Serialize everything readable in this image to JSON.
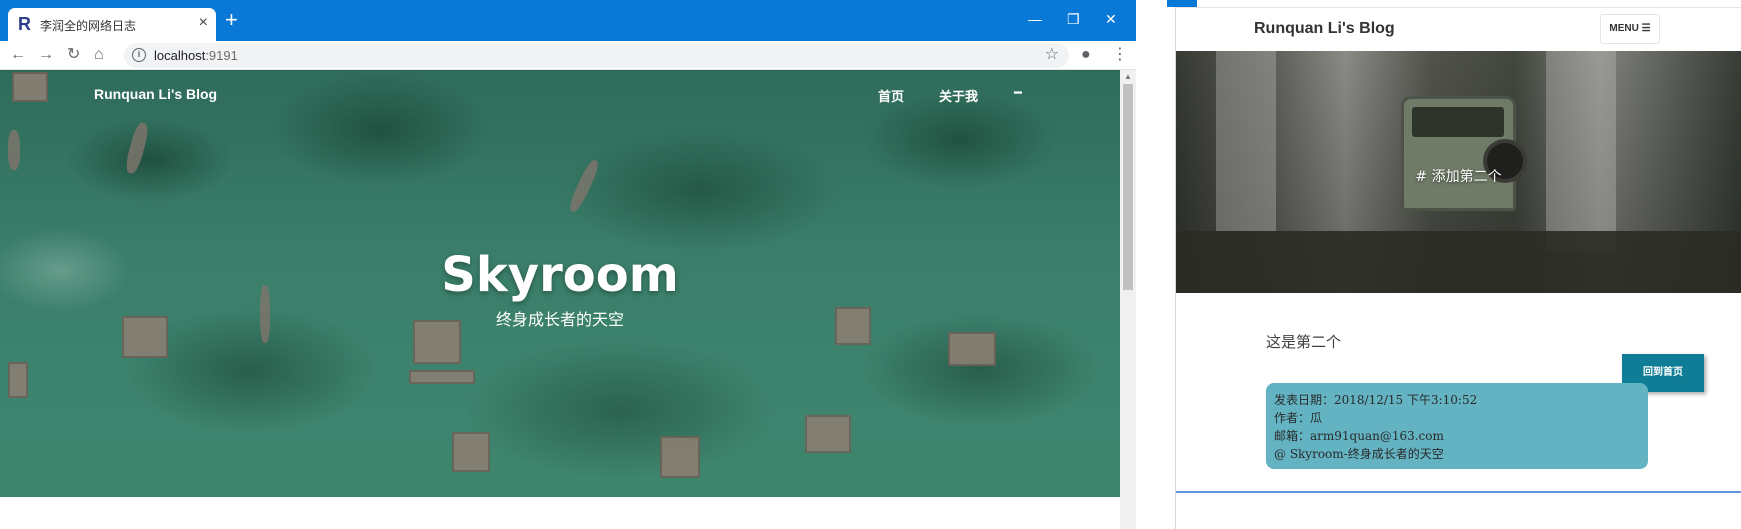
{
  "browser": {
    "tab_title": "李润全的网络日志",
    "favicon_letter": "R",
    "tab_close": "×",
    "new_tab": "+",
    "window_controls": {
      "minimize": "—",
      "restore": "❐",
      "close": "✕"
    },
    "nav": {
      "back": "←",
      "forward": "→",
      "reload": "↻",
      "home": "⌂"
    },
    "url_host": "localhost",
    "url_port": ":9191",
    "star": "☆",
    "profile": "●",
    "menu": "⋮"
  },
  "blog_home": {
    "brand": "Runquan Li's Blog",
    "nav_home": "首页",
    "nav_about": "关于我",
    "nav_extra": "━",
    "hero_title": "Skyroom",
    "hero_subtitle": "终身成长者的天空"
  },
  "post_page": {
    "brand": "Runquan Li's Blog",
    "menu_label": "MENU ☰",
    "hero_title": "# 添加第二个",
    "content": "这是第二个",
    "home_button": "回到首页",
    "meta": {
      "date_line": "发表日期：2018/12/15 下午3:10:52",
      "author_line": "作者：瓜",
      "email_line": "邮箱：arm91quan@163.com",
      "site_line": "@ Skyroom-终身成长者的天空"
    }
  },
  "colors": {
    "titlebar": "#0a78d7",
    "hero_water": "#3b7f6b",
    "button_teal": "#0f7d96",
    "meta_box": "#63b3c3"
  }
}
